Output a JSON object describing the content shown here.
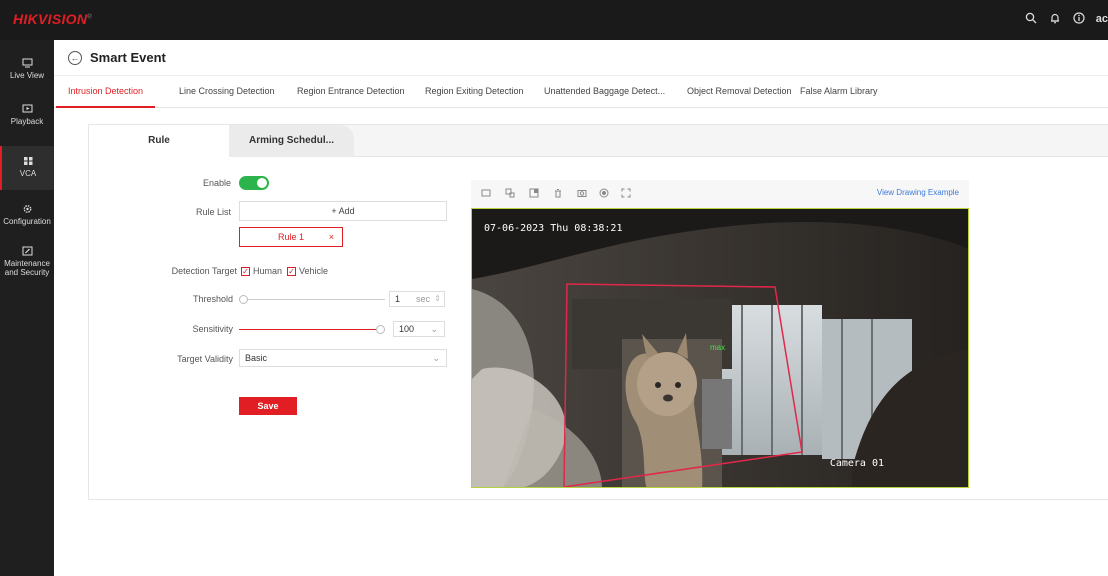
{
  "brand": {
    "logo": "HIKVISION",
    "mark": "®"
  },
  "top_bar": {
    "icons": [
      "search-icon",
      "bell-icon",
      "info-icon"
    ],
    "user": "ac"
  },
  "sidebar": {
    "items": [
      {
        "label": "Live View",
        "icon": "monitor-icon"
      },
      {
        "label": "Playback",
        "icon": "play-icon"
      },
      {
        "label": "VCA",
        "icon": "grid-icon",
        "active": true
      },
      {
        "label": "Configuration",
        "icon": "gear-icon"
      },
      {
        "label": "Maintenance and Security",
        "icon": "wrench-icon"
      }
    ]
  },
  "header": {
    "title": "Smart Event"
  },
  "tabs": [
    {
      "label": "Intrusion Detection",
      "active": true
    },
    {
      "label": "Line Crossing Detection"
    },
    {
      "label": "Region Entrance Detection"
    },
    {
      "label": "Region Exiting Detection"
    },
    {
      "label": "Unattended Baggage Detect..."
    },
    {
      "label": "Object Removal Detection"
    },
    {
      "label": "False Alarm Library"
    }
  ],
  "subtabs": [
    {
      "label": "Rule",
      "active": true
    },
    {
      "label": "Arming Schedul..."
    }
  ],
  "form": {
    "enable_label": "Enable",
    "enabled": true,
    "rule_list_label": "Rule List",
    "add_label": "+ Add",
    "rule_item": "Rule 1",
    "remove_glyph": "×",
    "detection_target_label": "Detection Target",
    "targets": [
      {
        "label": "Human",
        "checked": true
      },
      {
        "label": "Vehicle",
        "checked": true
      }
    ],
    "check_glyph": "✓",
    "threshold_label": "Threshold",
    "threshold_value": "1",
    "threshold_unit": "sec",
    "threshold_fraction": 0.0,
    "sensitivity_label": "Sensitivity",
    "sensitivity_value": "100",
    "sensitivity_fraction": 1.0,
    "target_validity_label": "Target Validity",
    "target_validity_value": "Basic",
    "save_label": "Save"
  },
  "video": {
    "toolbar_icons": [
      "rectangle-icon",
      "max-size-icon",
      "min-size-icon",
      "delete-icon",
      "capture-icon",
      "record-icon",
      "fullscreen-icon"
    ],
    "drawing_example_link": "View Drawing Example",
    "osd_time": "07-06-2023 Thu 08:38:21",
    "osd_camera": "Camera 01",
    "osd_max": "max"
  },
  "colors": {
    "accent": "#e01e23",
    "toggle_on": "#2bb44b",
    "link": "#3d7ad8",
    "video_border": "#b5d33a"
  }
}
